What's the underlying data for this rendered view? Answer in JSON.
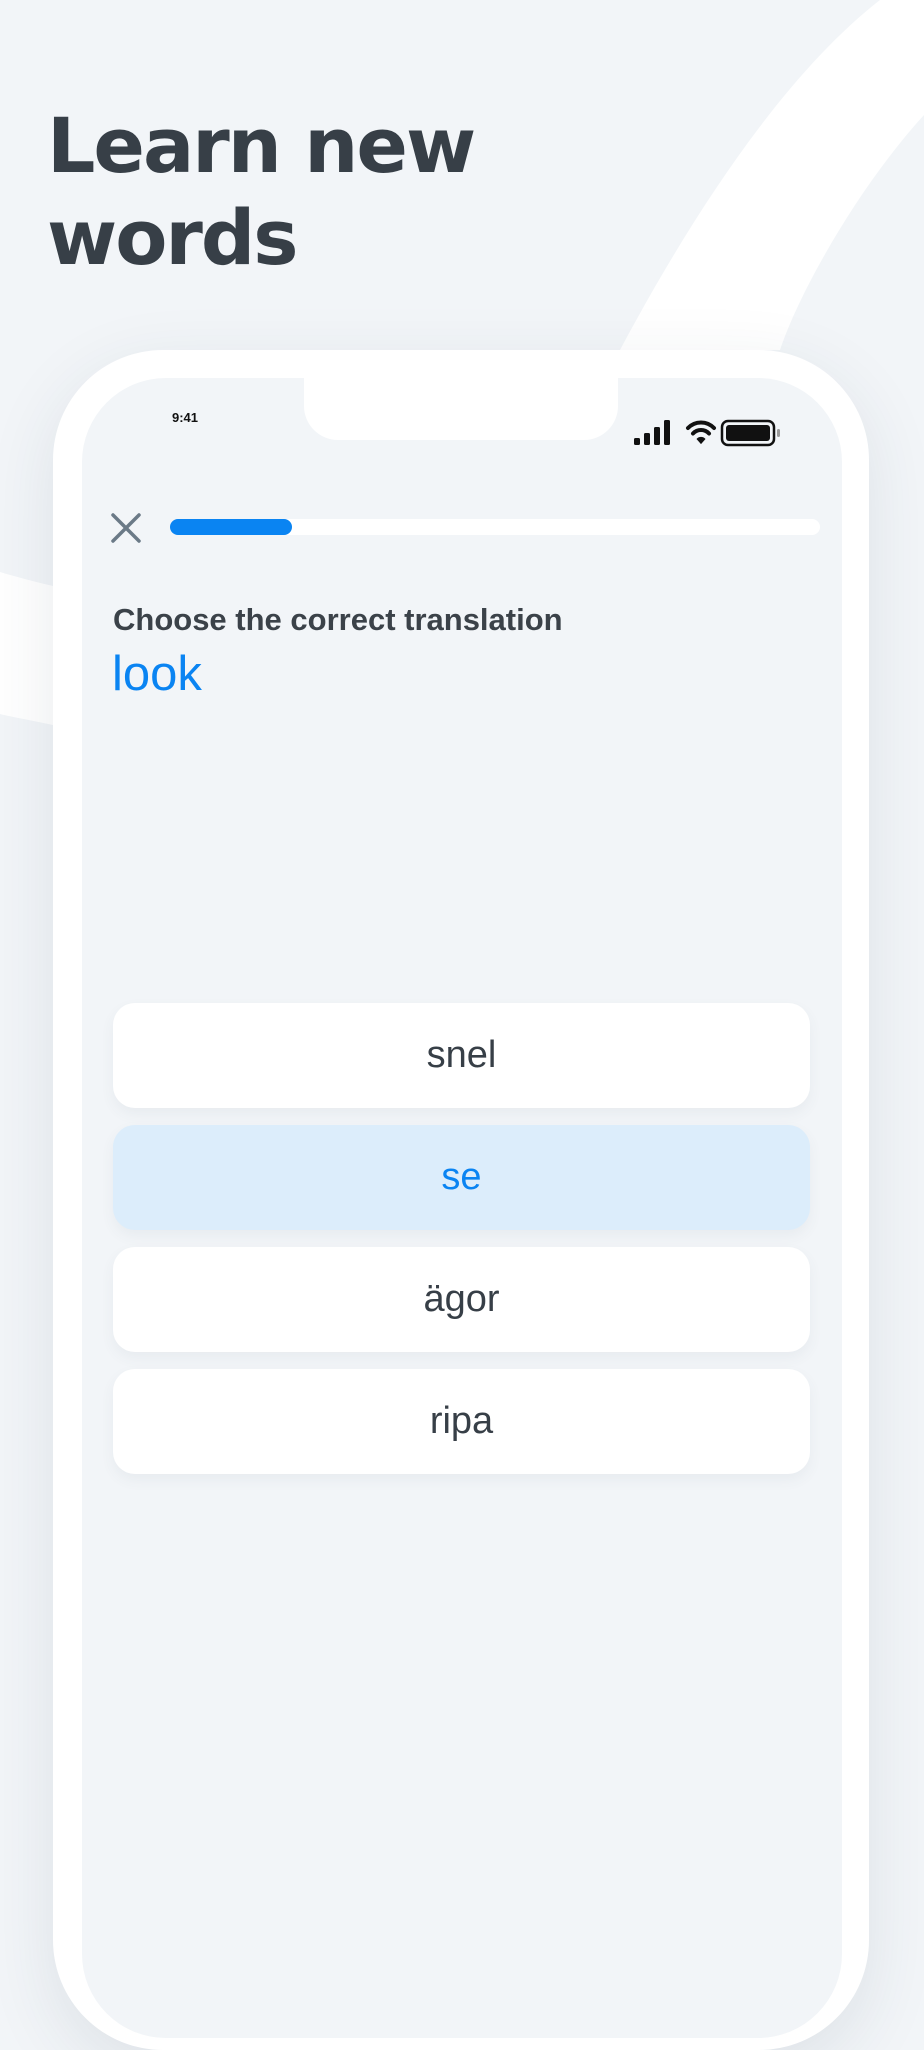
{
  "headline": "Learn new words",
  "colors": {
    "accent": "#0a84f2",
    "selected_bg": "#dcedfb",
    "text_dark": "#373f47",
    "background": "#f2f5f8"
  },
  "status_bar": {
    "time": "9:41",
    "icons": [
      "cellular-signal-icon",
      "wifi-icon",
      "battery-icon"
    ]
  },
  "quiz": {
    "close_icon": "close-icon",
    "progress": 0.187,
    "prompt": "Choose the correct translation",
    "word": "look",
    "options": [
      {
        "label": "snel",
        "selected": false
      },
      {
        "label": "se",
        "selected": true
      },
      {
        "label": "ägor",
        "selected": false
      },
      {
        "label": "ripa",
        "selected": false
      }
    ]
  }
}
